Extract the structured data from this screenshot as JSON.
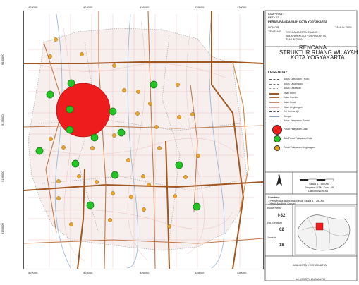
{
  "coords": {
    "top": [
      "422000",
      "424000",
      "426000",
      "428000",
      "430000"
    ],
    "bottom": [
      "422000",
      "424000",
      "426000",
      "428000",
      "430000"
    ],
    "left": [
      "9140000",
      "9138000",
      "9136000",
      "9134000",
      "9132000"
    ]
  },
  "titleblock": {
    "lampiran": "LAMPIRAN I",
    "perda": "PETA 02",
    "peraturan": "PERATURAN DAERAH KOTA YOGYAKARTA",
    "nomor_label": "NOMOR",
    "nomor_value": ":",
    "tahun": "TAHUN 2009",
    "tentang_label": "TENTANG",
    "tentang_value": "RENCANA TATA RUANG WILAYAH KOTA YOGYAKARTA",
    "tahun2": "TAHUN 2009",
    "title1": "RENCANA",
    "title2": "STRUKTUR RUANG WILAYAH",
    "title3": "KOTA YOGYAKARTA"
  },
  "legend": {
    "header": "LEGENDA :",
    "lines": [
      {
        "label": "Batas Kabupaten / Kota",
        "color": "#555555",
        "style": "dashed"
      },
      {
        "label": "Batas Kecamatan",
        "color": "#777777",
        "style": "dashed"
      },
      {
        "label": "Batas Kelurahan",
        "color": "#999999",
        "style": "dotted"
      },
      {
        "label": "Jalan Arteri",
        "color": "#9b5a2a",
        "style": "solid"
      },
      {
        "label": "Jalan Kolektor",
        "color": "#b8683a",
        "style": "solid"
      },
      {
        "label": "Jalan Lokal",
        "color": "#c98a6a",
        "style": "solid"
      },
      {
        "label": "Jalan Lingkungan",
        "color": "#e0b0a8",
        "style": "solid"
      },
      {
        "label": "Rel Kereta Api",
        "color": "#444444",
        "style": "dashed"
      },
      {
        "label": "Sungai",
        "color": "#7fa6c9",
        "style": "solid"
      },
      {
        "label": "Batas Sempadan Pantai",
        "color": "#888888",
        "style": "dashed"
      }
    ],
    "symbols": [
      {
        "label": "Pusat Pelayanan Kota",
        "color": "#ee1c1c"
      },
      {
        "label": "Sub Pusat Pelayanan Kota",
        "color": "#22cc22"
      },
      {
        "label": "Pusat Pelayanan Lingkungan",
        "color": "#e8a020"
      }
    ]
  },
  "north_label": "U",
  "scale": {
    "text1": "Skala 1 : 50.000",
    "text2": "Proyeksi UTM Zona 49",
    "text3": "Datum WGS 84"
  },
  "source": {
    "label": "Sumber :",
    "line1": "- Peta Rupa Bumi Indonesia Skala 1 : 25.000",
    "line2": "- Hasil Analisis Survei"
  },
  "boxes": {
    "kode_label": "Kode Peta",
    "kode_value": "I-32",
    "lembar_label": "No. Lembar",
    "lembar_value": "02",
    "jumlah_label": "Jumlah",
    "jumlah_value": "18"
  },
  "signature": {
    "title": "WALIKOTA YOGYAKARTA",
    "name": "ttd. HERRY ZUDIANTO"
  },
  "map_points": {
    "center": {
      "label": "Pusat Pelayanan Kota"
    },
    "green_count": 14,
    "orange_count": 32
  }
}
